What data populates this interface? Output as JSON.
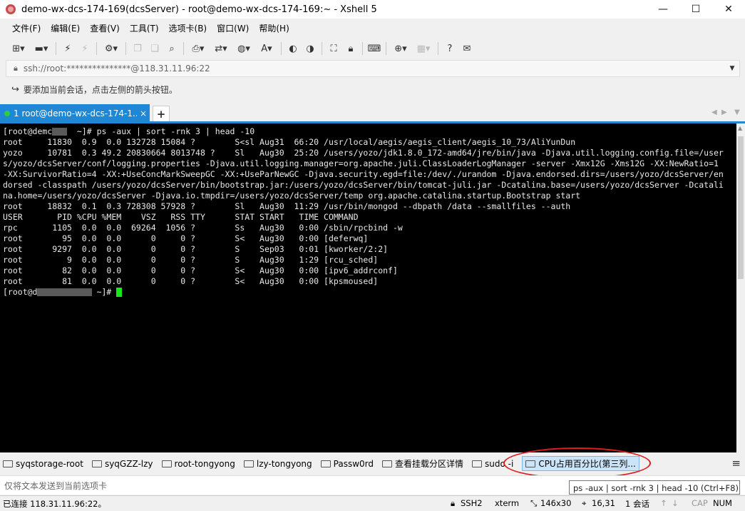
{
  "window": {
    "title": "demo-wx-dcs-174-169(dcsServer) - root@demo-wx-dcs-174-169:~ - Xshell 5",
    "minimize": "—",
    "maximize": "☐",
    "close": "✕"
  },
  "menu": {
    "items": [
      "文件(F)",
      "编辑(E)",
      "查看(V)",
      "工具(T)",
      "选项卡(B)",
      "窗口(W)",
      "帮助(H)"
    ]
  },
  "address": {
    "value": "ssh://root:***************@118.31.11.96:22"
  },
  "hint": {
    "text": "要添加当前会话，点击左侧的箭头按钮。"
  },
  "tabs": {
    "active_label": "1 root@demo-wx-dcs-174-1...",
    "close": "×",
    "add": "+"
  },
  "terminal": {
    "lines": [
      {
        "pre": "[root@demc",
        "blur": "   ",
        "post": "  ~]# ps -aux | sort -rnk 3 | head -10"
      },
      {
        "text": "root     11830  0.9  0.0 132728 15084 ?        S<sl Aug31  66:20 /usr/local/aegis/aegis_client/aegis_10_73/AliYunDun"
      },
      {
        "text": "yozo     10781  0.3 49.2 20830664 8013748 ?    Sl   Aug30  25:20 /users/yozo/jdk1.8.0_172-amd64/jre/bin/java -Djava.util.logging.config.file=/user"
      },
      {
        "text": "s/yozo/dcsServer/conf/logging.properties -Djava.util.logging.manager=org.apache.juli.ClassLoaderLogManager -server -Xmx12G -Xms12G -XX:NewRatio=1"
      },
      {
        "text": "-XX:SurvivorRatio=4 -XX:+UseConcMarkSweepGC -XX:+UseParNewGC -Djava.security.egd=file:/dev/./urandom -Djava.endorsed.dirs=/users/yozo/dcsServer/en"
      },
      {
        "text": "dorsed -classpath /users/yozo/dcsServer/bin/bootstrap.jar:/users/yozo/dcsServer/bin/tomcat-juli.jar -Dcatalina.base=/users/yozo/dcsServer -Dcatali"
      },
      {
        "text": "na.home=/users/yozo/dcsServer -Djava.io.tmpdir=/users/yozo/dcsServer/temp org.apache.catalina.startup.Bootstrap start"
      },
      {
        "text": "root     18832  0.1  0.3 728308 57928 ?        Sl   Aug30  11:29 /usr/bin/mongod --dbpath /data --smallfiles --auth"
      },
      {
        "text": "USER       PID %CPU %MEM    VSZ   RSS TTY      STAT START   TIME COMMAND"
      },
      {
        "text": "rpc       1105  0.0  0.0  69264  1056 ?        Ss   Aug30   0:00 /sbin/rpcbind -w"
      },
      {
        "text": "root        95  0.0  0.0      0     0 ?        S<   Aug30   0:00 [deferwq]"
      },
      {
        "text": "root      9297  0.0  0.0      0     0 ?        S    Sep03   0:01 [kworker/2:2]"
      },
      {
        "text": "root         9  0.0  0.0      0     0 ?        S    Aug30   1:29 [rcu_sched]"
      },
      {
        "text": "root        82  0.0  0.0      0     0 ?        S<   Aug30   0:00 [ipv6_addrconf]"
      },
      {
        "text": "root        81  0.0  0.0      0     0 ?        S<   Aug30   0:00 [kpsmoused]"
      },
      {
        "pre": "[root@d",
        "blur": "           ",
        "post": " ~]# ",
        "cursor": true
      }
    ]
  },
  "quickbar": {
    "items": [
      "syqstorage-root",
      "syqGZZ-lzy",
      "root-tongyong",
      "lzy-tongyong",
      "Passw0rd",
      "查看挂载分区详情",
      "sudo -i",
      "CPU占用百分比(第三列..."
    ],
    "menu": "≡"
  },
  "send": {
    "placeholder": "仅将文本发送到当前选项卡"
  },
  "tooltip": {
    "text": "ps -aux | sort -rnk 3 | head -10 (Ctrl+F8)"
  },
  "status": {
    "connection": "已连接 118.31.11.96:22。",
    "protocol": "SSH2",
    "terminal_type": "xterm",
    "size": "146x30",
    "cursor_pos": "16,31",
    "sessions": "1 会话",
    "cap": "CAP",
    "num": "NUM"
  }
}
